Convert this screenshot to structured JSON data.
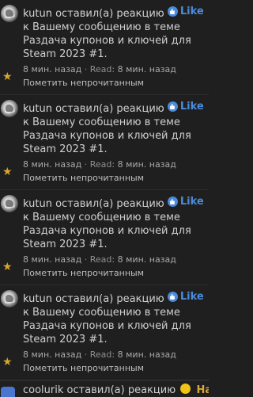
{
  "notifications": [
    {
      "user": "kutun",
      "action": "оставил(а) реакцию",
      "reaction": "Like",
      "message": "к Вашему сообщению в теме Раздача купонов и ключей для Steam 2023 #1.",
      "time": "8 мин. назад",
      "separator": "·",
      "read_label": "Read:",
      "read_time": "8 мин. назад",
      "mark_unread": "Пометить непрочитанным"
    },
    {
      "user": "kutun",
      "action": "оставил(а) реакцию",
      "reaction": "Like",
      "message": "к Вашему сообщению в теме Раздача купонов и ключей для Steam 2023 #1.",
      "time": "8 мин. назад",
      "separator": "·",
      "read_label": "Read:",
      "read_time": "8 мин. назад",
      "mark_unread": "Пометить непрочитанным"
    },
    {
      "user": "kutun",
      "action": "оставил(а) реакцию",
      "reaction": "Like",
      "message": "к Вашему сообщению в теме Раздача купонов и ключей для Steam 2023 #1.",
      "time": "8 мин. назад",
      "separator": "·",
      "read_label": "Read:",
      "read_time": "8 мин. назад",
      "mark_unread": "Пометить непрочитанным"
    },
    {
      "user": "kutun",
      "action": "оставил(а) реакцию",
      "reaction": "Like",
      "message": "к Вашему сообщению в теме Раздача купонов и ключей для Steam 2023 #1.",
      "time": "8 мин. назад",
      "separator": "·",
      "read_label": "Read:",
      "read_time": "8 мин. назад",
      "mark_unread": "Пометить непрочитанным"
    }
  ],
  "partial": {
    "user": "coolurik",
    "action": "оставил(а) реакцию",
    "reaction": "Haha"
  },
  "colors": {
    "background": "#1f1f1f",
    "like": "#4a8bdc",
    "star": "#d9a62a",
    "haha": "#f0c419"
  },
  "icons": {
    "star": "star-icon",
    "like": "like-icon",
    "haha": "haha-icon"
  }
}
